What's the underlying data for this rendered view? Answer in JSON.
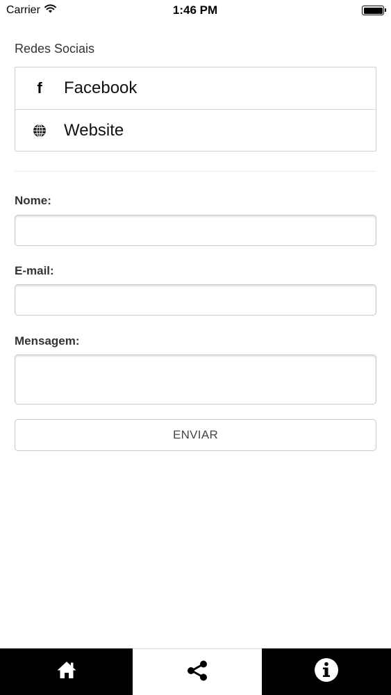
{
  "status_bar": {
    "carrier": "Carrier",
    "time": "1:46 PM"
  },
  "social": {
    "title": "Redes Sociais",
    "items": [
      {
        "label": "Facebook",
        "icon": "facebook-icon",
        "glyph": "f"
      },
      {
        "label": "Website",
        "icon": "globe-icon"
      }
    ]
  },
  "form": {
    "name_label": "Nome:",
    "name_value": "",
    "email_label": "E-mail:",
    "email_value": "",
    "message_label": "Mensagem:",
    "message_value": "",
    "submit_label": "ENVIAR"
  },
  "tab_bar": {
    "tabs": [
      {
        "icon": "home-icon",
        "active": false
      },
      {
        "icon": "share-icon",
        "active": true
      },
      {
        "icon": "info-icon",
        "active": false
      }
    ]
  },
  "colors": {
    "tab_bar_background": "#000000",
    "active_tab_background": "#ffffff",
    "border": "#c8c8c8"
  }
}
